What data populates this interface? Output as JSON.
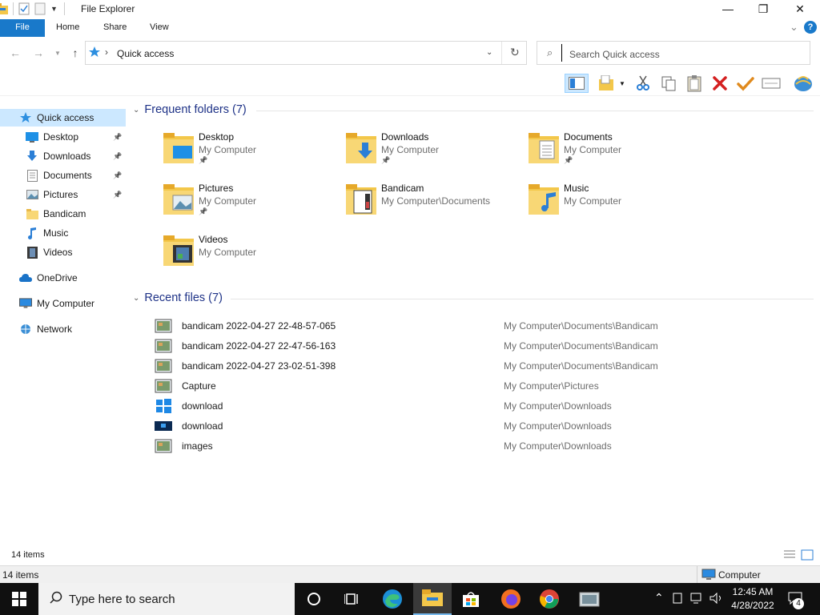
{
  "window": {
    "title": "File Explorer",
    "minimize": "—",
    "maximize": "❐",
    "close": "✕"
  },
  "ribbon": {
    "tabs": [
      "File",
      "Home",
      "Share",
      "View"
    ],
    "help": "?",
    "collapse": "⌄"
  },
  "address": {
    "location": "Quick access",
    "separator": "›"
  },
  "search": {
    "placeholder": "Search Quick access"
  },
  "nav": {
    "items": [
      {
        "label": "Quick access",
        "icon": "star-icon",
        "pinned": false,
        "indent": 0
      },
      {
        "label": "Desktop",
        "icon": "desktop-icon",
        "pinned": true,
        "indent": 1
      },
      {
        "label": "Downloads",
        "icon": "downloads-icon",
        "pinned": true,
        "indent": 1
      },
      {
        "label": "Documents",
        "icon": "documents-icon",
        "pinned": true,
        "indent": 1
      },
      {
        "label": "Pictures",
        "icon": "pictures-icon",
        "pinned": true,
        "indent": 1
      },
      {
        "label": "Bandicam",
        "icon": "folder-icon",
        "pinned": false,
        "indent": 1
      },
      {
        "label": "Music",
        "icon": "music-icon",
        "pinned": false,
        "indent": 1
      },
      {
        "label": "Videos",
        "icon": "videos-icon",
        "pinned": false,
        "indent": 1
      },
      {
        "label": "OneDrive",
        "icon": "cloud-icon",
        "pinned": false,
        "indent": 0
      },
      {
        "label": "My Computer",
        "icon": "computer-icon",
        "pinned": false,
        "indent": 0
      },
      {
        "label": "Network",
        "icon": "network-icon",
        "pinned": false,
        "indent": 0
      }
    ]
  },
  "frequent": {
    "header": "Frequent folders (7)",
    "folders": [
      {
        "name": "Desktop",
        "path": "My Computer",
        "pinned": true,
        "icon": "desktop-folder-icon"
      },
      {
        "name": "Downloads",
        "path": "My Computer",
        "pinned": true,
        "icon": "downloads-folder-icon"
      },
      {
        "name": "Documents",
        "path": "My Computer",
        "pinned": true,
        "icon": "documents-folder-icon"
      },
      {
        "name": "Pictures",
        "path": "My Computer",
        "pinned": true,
        "icon": "pictures-folder-icon"
      },
      {
        "name": "Bandicam",
        "path": "My Computer\\Documents",
        "pinned": false,
        "icon": "bandicam-folder-icon"
      },
      {
        "name": "Music",
        "path": "My Computer",
        "pinned": false,
        "icon": "music-folder-icon"
      },
      {
        "name": "Videos",
        "path": "My Computer",
        "pinned": false,
        "icon": "videos-folder-icon"
      }
    ]
  },
  "recent": {
    "header": "Recent files (7)",
    "files": [
      {
        "name": "bandicam 2022-04-27 22-48-57-065",
        "path": "My Computer\\Documents\\Bandicam",
        "icon": "image-thumb-icon"
      },
      {
        "name": "bandicam 2022-04-27 22-47-56-163",
        "path": "My Computer\\Documents\\Bandicam",
        "icon": "image-thumb-icon"
      },
      {
        "name": "bandicam 2022-04-27 23-02-51-398",
        "path": "My Computer\\Documents\\Bandicam",
        "icon": "image-thumb-icon"
      },
      {
        "name": "Capture",
        "path": "My Computer\\Pictures",
        "icon": "image-thumb-icon"
      },
      {
        "name": "download",
        "path": "My Computer\\Downloads",
        "icon": "windows-logo-thumb-icon"
      },
      {
        "name": "download",
        "path": "My Computer\\Downloads",
        "icon": "windows-wallpaper-thumb-icon"
      },
      {
        "name": "images",
        "path": "My Computer\\Downloads",
        "icon": "image-thumb-icon"
      }
    ]
  },
  "status": {
    "items_count": "14 items",
    "bottom_count": "14 items",
    "location_label": "Computer"
  },
  "taskbar": {
    "search_placeholder": "Type here to search",
    "time": "12:45 AM",
    "date": "4/28/2022",
    "notifications": "4"
  },
  "colors": {
    "accent": "#1979ca",
    "section_header": "#1e3287",
    "selected_nav": "#cce8ff",
    "taskbar": "#101010"
  }
}
